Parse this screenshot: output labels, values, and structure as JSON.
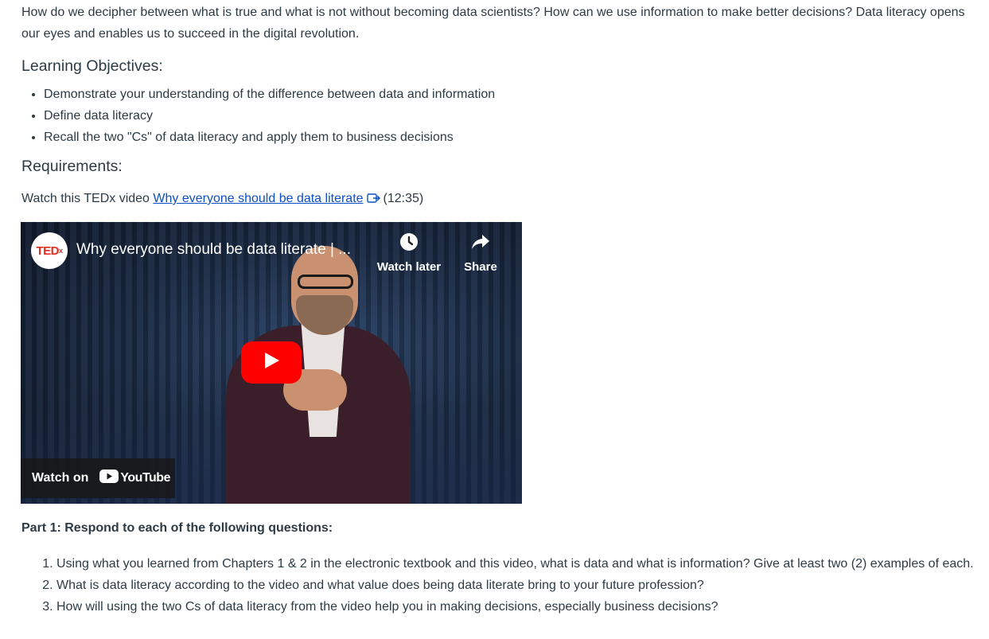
{
  "intro": "How do we decipher between what is true and what is not without becoming data scientists? How can we use information to make better decisions? Data literacy opens our eyes and enables us to succeed in the digital revolution.",
  "objectives": {
    "heading": "Learning Objectives:",
    "items": [
      "Demonstrate your understanding of the difference between data and information",
      "Define data literacy",
      "Recall the two \"Cs\" of data literacy and apply them to business decisions"
    ]
  },
  "requirements": {
    "heading": "Requirements:",
    "watch_prefix": "Watch this TEDx video ",
    "link_text": "Why everyone should be data literate",
    "duration": "(12:35)"
  },
  "video": {
    "channel_badge": "TED",
    "channel_badge_suffix": "x",
    "title": "Why everyone should be data literate | ...",
    "watch_later": "Watch later",
    "share": "Share",
    "watch_on": "Watch on",
    "youtube": "YouTube"
  },
  "part1": {
    "heading": "Part 1: Respond to each of the following questions:",
    "questions": [
      "Using what you learned from Chapters 1 & 2 in the electronic textbook and this video, what is data and what is information? Give at least two (2) examples of each.",
      "What is data literacy according to the video and what value does being data literate bring to your future profession?",
      "How will using the two Cs of data literacy from the video help you in making decisions, especially business decisions?"
    ]
  },
  "colors": {
    "text": "#2d3b45",
    "link": "#0b4fc4",
    "youtube_red": "#ff0000",
    "ted_red": "#e62b1e"
  }
}
